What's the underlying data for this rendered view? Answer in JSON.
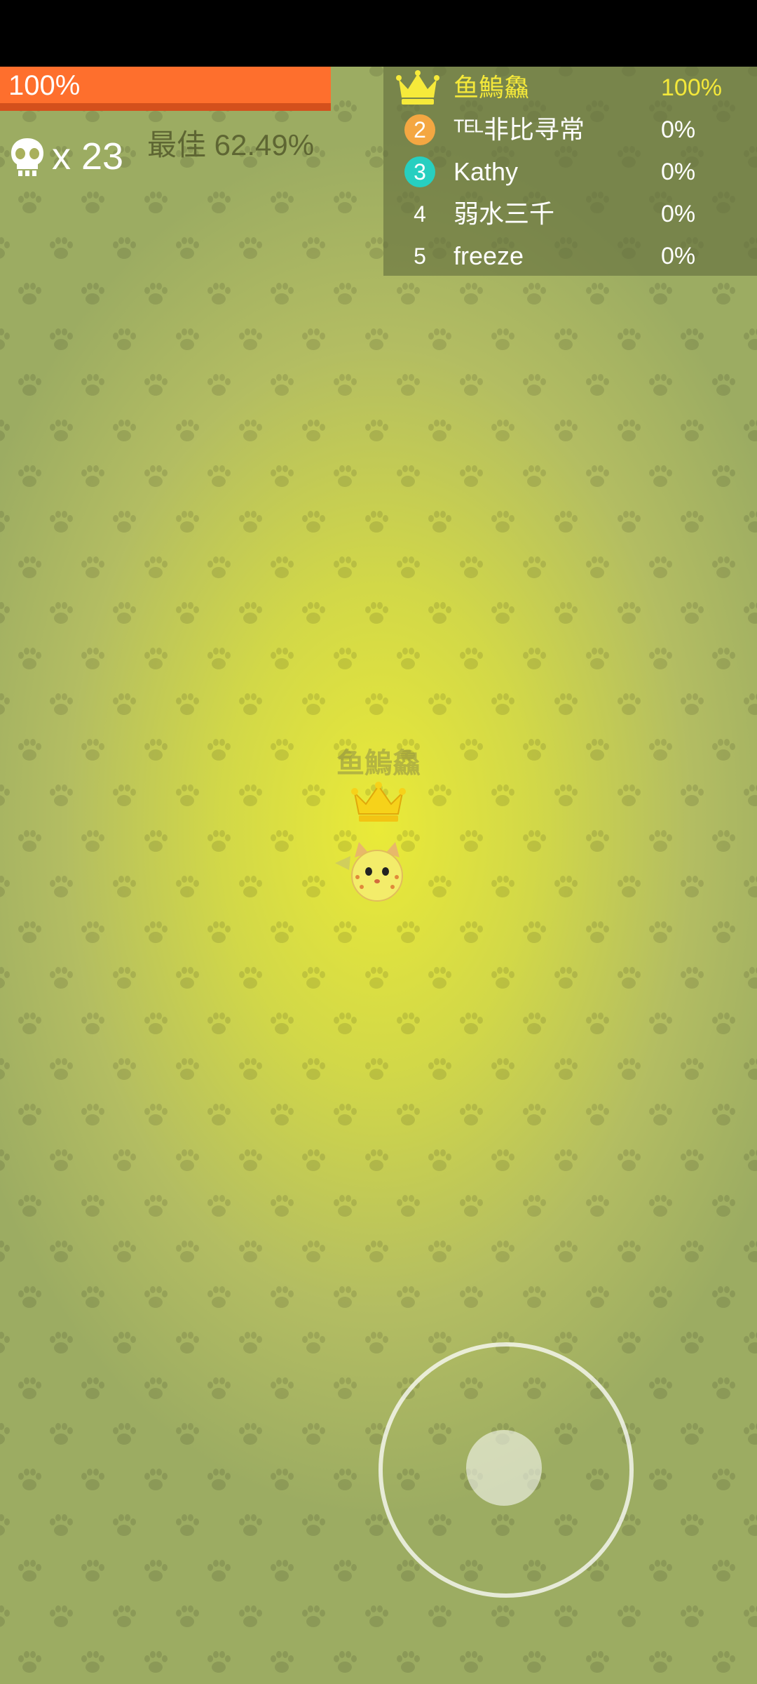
{
  "hud": {
    "progress_label": "100%",
    "progress_fraction": 1.0,
    "kills_prefix": "x 23",
    "best_label": "最佳 62.49%"
  },
  "leaderboard": {
    "rows": [
      {
        "rank": "",
        "badge": "crown-icon",
        "name": "鱼鰞鱻",
        "percent": "100%"
      },
      {
        "rank": "2",
        "badge_color": "#f4a742",
        "name": "ᵀᴱᴸ非比寻常",
        "percent": "0%"
      },
      {
        "rank": "3",
        "badge_color": "#27cfc0",
        "name": "Kathy",
        "percent": "0%"
      },
      {
        "rank": "4",
        "name": "弱水三千",
        "percent": "0%"
      },
      {
        "rank": "5",
        "name": "freeze",
        "percent": "0%"
      }
    ]
  },
  "player": {
    "name": "鱼鰞鱻",
    "crown_icon": "crown-icon",
    "avatar_icon": "cat-icon"
  },
  "colors": {
    "progress": "#fe6f2d",
    "leader_text": "#f4e83a",
    "background_center": "#eaea38",
    "background_edge": "#9cac62"
  }
}
